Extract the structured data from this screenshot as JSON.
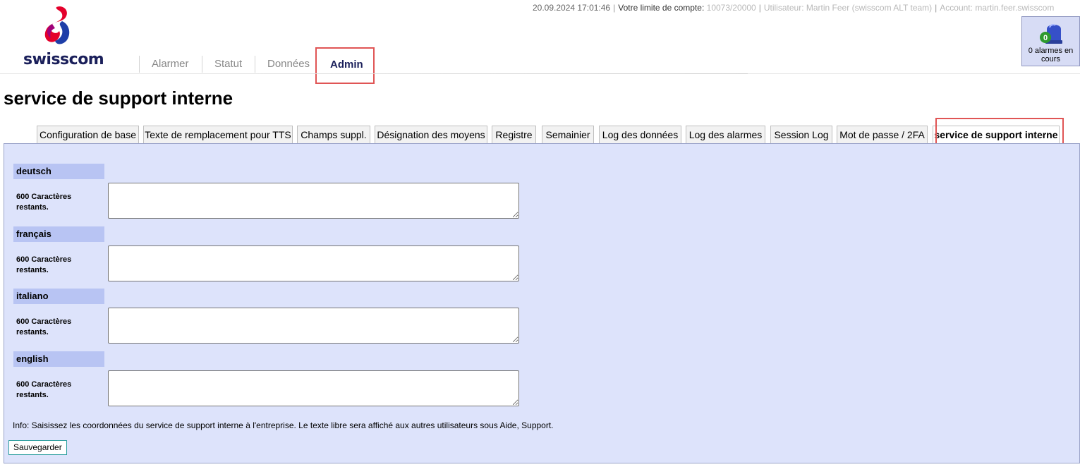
{
  "header": {
    "brand": "swisscom",
    "date": "20.09.2024 17:01:46",
    "limit_label": "Votre limite de compte:",
    "limit_value": "10073/20000",
    "user_label": "Utilisateur:",
    "user_value": "Martin Feer",
    "team": "(swisscom ALT team)",
    "account_label": "Account:",
    "account_value": "martin.feer.swisscom"
  },
  "alarm": {
    "count": "0",
    "label": "0 alarmes en cours"
  },
  "mainnav": {
    "items": [
      {
        "label": "Alarmer"
      },
      {
        "label": "Statut"
      },
      {
        "label": "Données"
      },
      {
        "label": "Admin"
      }
    ]
  },
  "page": {
    "title": "service de support interne"
  },
  "tabs": [
    {
      "label": "Configuration de base"
    },
    {
      "label": "Texte de remplacement pour TTS"
    },
    {
      "label": "Champs suppl."
    },
    {
      "label": "Désignation des moyens"
    },
    {
      "label": "Registre"
    },
    {
      "label": "Semainier"
    },
    {
      "label": "Log des données"
    },
    {
      "label": "Log des alarmes"
    },
    {
      "label": "Session Log"
    },
    {
      "label": "Mot de passe / 2FA"
    },
    {
      "label": "service de support interne"
    }
  ],
  "languages": [
    {
      "name": "deutsch",
      "chars_left": "600 Caractères restants.",
      "value": ""
    },
    {
      "name": "français",
      "chars_left": "600 Caractères restants.",
      "value": ""
    },
    {
      "name": "italiano",
      "chars_left": "600 Caractères restants.",
      "value": ""
    },
    {
      "name": "english",
      "chars_left": "600 Caractères restants.",
      "value": ""
    }
  ],
  "info": "Info: Saisissez les coordonnées du service de support interne à l'entreprise. Le texte libre sera affiché aux autres utilisateurs sous Aide, Support.",
  "save_label": "Sauvegarder",
  "colors": {
    "brand_navy": "#1a1f5a",
    "panel": "#dde3fb",
    "lang_header": "#b8c4f3",
    "highlight": "#e05555"
  }
}
